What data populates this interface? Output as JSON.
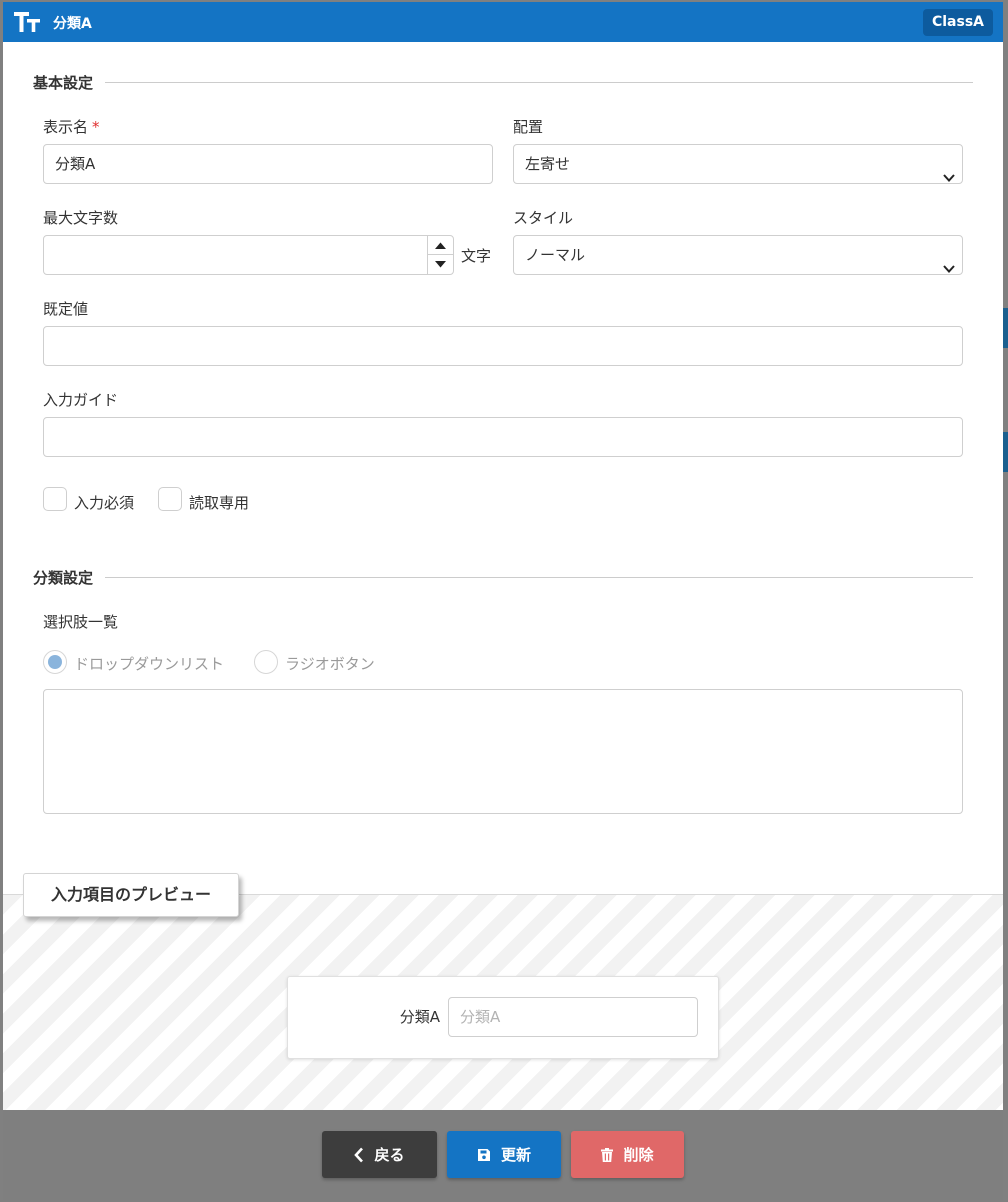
{
  "window": {
    "title": "分類A",
    "class_badge": "ClassA",
    "accent_color": "#1474c4"
  },
  "basic_settings": {
    "heading": "基本設定",
    "display_name": {
      "label": "表示名",
      "required_mark": "*",
      "value": "分類A"
    },
    "alignment": {
      "label": "配置",
      "selected": "左寄せ"
    },
    "max_chars": {
      "label": "最大文字数",
      "value": "",
      "unit": "文字"
    },
    "style": {
      "label": "スタイル",
      "selected": "ノーマル"
    },
    "default_value": {
      "label": "既定値",
      "value": ""
    },
    "input_guide": {
      "label": "入力ガイド",
      "value": ""
    },
    "required_checkbox": {
      "label": "入力必須",
      "checked": false
    },
    "readonly_checkbox": {
      "label": "読取専用",
      "checked": false
    }
  },
  "category_settings": {
    "heading": "分類設定",
    "options_label": "選択肢一覧",
    "radio_dropdown": {
      "label": "ドロップダウンリスト",
      "selected": true
    },
    "radio_radio": {
      "label": "ラジオボタン",
      "selected": false
    },
    "options_text": ""
  },
  "preview": {
    "tab_label": "入力項目のプレビュー",
    "field_label": "分類A",
    "field_placeholder": "分類A"
  },
  "footer": {
    "back_label": "戻る",
    "update_label": "更新",
    "delete_label": "削除"
  }
}
